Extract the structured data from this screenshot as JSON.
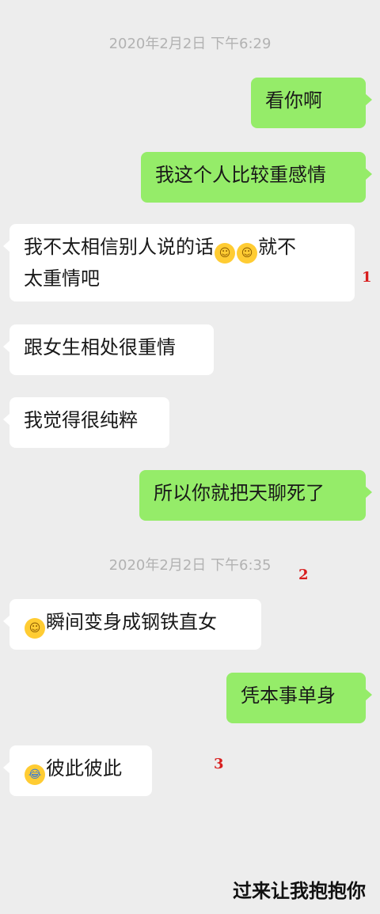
{
  "timestamps": [
    "2020年2月2日 下午6:29",
    "2020年2月2日 下午6:35"
  ],
  "messages": {
    "m1": "看你啊",
    "m2": "我这个人比较重感情",
    "m3a": "我不太相信别人说的话",
    "m3b": "就不",
    "m3c": "太重情吧",
    "m4": "跟女生相处很重情",
    "m5": "我觉得很纯粹",
    "m6": "所以你就把天聊死了",
    "m7": "瞬间变身成钢铁直女",
    "m8": "凭本事单身",
    "m9": "彼此彼此"
  },
  "markers": [
    "1",
    "2",
    "3"
  ],
  "caption": "过来让我抱抱你",
  "icons": {
    "smile": "smiling-face-icon",
    "laughcry": "laughing-crying-face-icon"
  },
  "colors": {
    "background": "#ededed",
    "outgoing": "#95ec69",
    "incoming": "#ffffff",
    "marker": "#d81e1e",
    "timestamp": "#b2b2b2"
  }
}
